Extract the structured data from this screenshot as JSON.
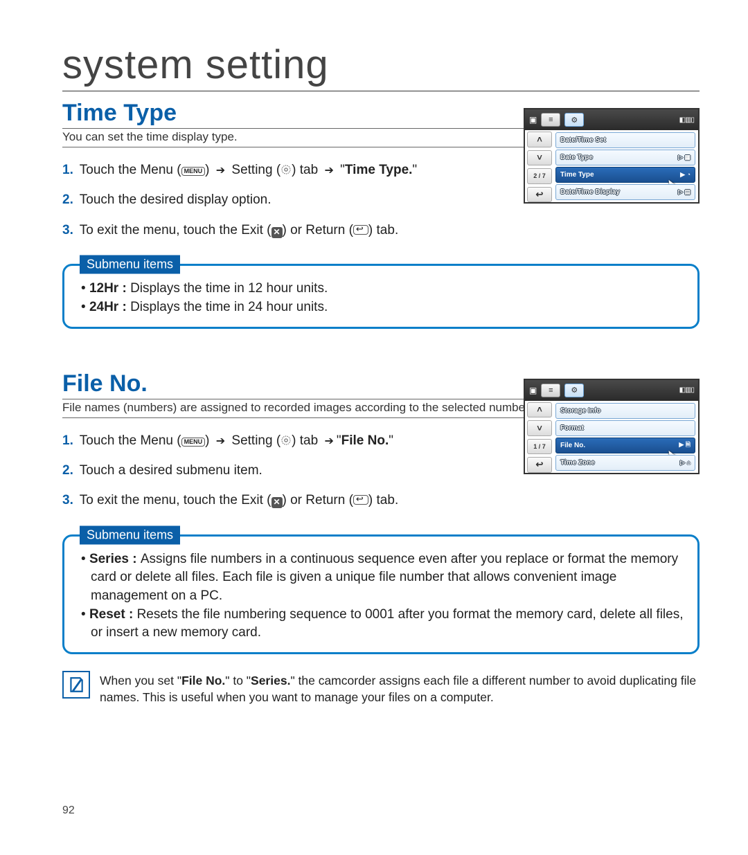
{
  "pageTitle": "system setting",
  "pageNumber": "92",
  "section1": {
    "heading": "Time Type",
    "desc": "You can set the time display type.",
    "step1_a": "Touch the Menu (",
    "step1_menuLabel": "MENU",
    "step1_b": ") ",
    "step1_c": " Setting (",
    "step1_d": ") tab ",
    "step1_e": " \"",
    "step1_target": "Time Type.",
    "step1_f": "\"",
    "step2": "Touch the desired display option.",
    "step3_a": "To exit the menu, touch the Exit (",
    "step3_b": ") or Return (",
    "step3_c": ") tab.",
    "subLabel": "Submenu items",
    "sub1_term": "12Hr : ",
    "sub1_def": "Displays the time in 12 hour units.",
    "sub2_term": "24Hr : ",
    "sub2_def": "Displays the time in 24 hour units.",
    "lcd": {
      "page": "2 / 7",
      "row1": "Date/Time Set",
      "row2": "Date Type",
      "row3": "Time Type",
      "row4": "Date/Time Display"
    }
  },
  "section2": {
    "heading": "File No.",
    "desc": "File names (numbers) are assigned to recorded images according to the selected numbering option.",
    "step1_a": "Touch the Menu (",
    "step1_b": ") ",
    "step1_c": " Setting (",
    "step1_d": ") tab ",
    "step1_e": "\"",
    "step1_target": "File No.",
    "step1_f": "\"",
    "step2": "Touch a desired submenu item.",
    "step3_a": "To exit the menu, touch the Exit (",
    "step3_b": ") or Return (",
    "step3_c": ") tab.",
    "subLabel": "Submenu items",
    "sub1_term": "Series : ",
    "sub1_def": "Assigns file numbers in a continuous sequence even after you replace or format the memory card or delete all files. Each file is given a unique file number that allows convenient image management on a PC.",
    "sub2_term": "Reset : ",
    "sub2_def": "Resets the file numbering sequence to 0001 after you format the memory card, delete all files, or insert a new memory card.",
    "lcd": {
      "page": "1 / 7",
      "row1": "Storage Info",
      "row2": "Format",
      "row3": "File No.",
      "row4": "Time Zone"
    }
  },
  "note": {
    "a": "When you set \"",
    "b": "File No.",
    "c": "\" to \"",
    "d": "Series.",
    "e": "\" the camcorder assigns each file a different number to avoid duplicating file names. This is useful when you want to manage your files on a computer."
  }
}
